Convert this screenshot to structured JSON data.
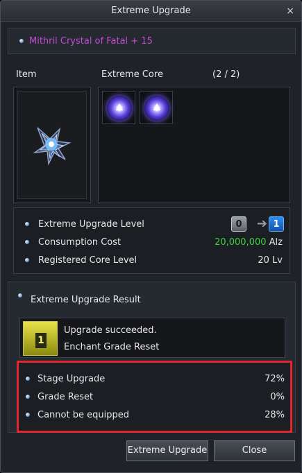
{
  "window": {
    "title": "Extreme Upgrade",
    "close_icon": "×"
  },
  "item_name": "Mithril Crystal of Fatal + 15",
  "labels": {
    "item": "Item",
    "extreme_core": "Extreme Core",
    "core_count": "(2 / 2)"
  },
  "info": {
    "upgrade_level_label": "Extreme Upgrade Level",
    "level_from": "0",
    "level_to": "1",
    "consumption_label": "Consumption Cost",
    "consumption_amount": "20,000,000",
    "consumption_unit": "Alz",
    "registered_label": "Registered Core Level",
    "registered_value": "20 Lv"
  },
  "result": {
    "title": "Extreme Upgrade Result",
    "icon_number": "1",
    "line1": "Upgrade succeeded.",
    "line2": "Enchant Grade Reset",
    "probabilities": [
      {
        "label": "Stage Upgrade",
        "value": "72%"
      },
      {
        "label": "Grade Reset",
        "value": "0%"
      },
      {
        "label": "Cannot be equipped",
        "value": "28%"
      }
    ]
  },
  "buttons": {
    "upgrade": "Extreme Upgrade",
    "close": "Close"
  },
  "colors": {
    "item_name": "#c24bd8",
    "cost": "#3fd13f",
    "highlight_border": "#e0262f"
  }
}
